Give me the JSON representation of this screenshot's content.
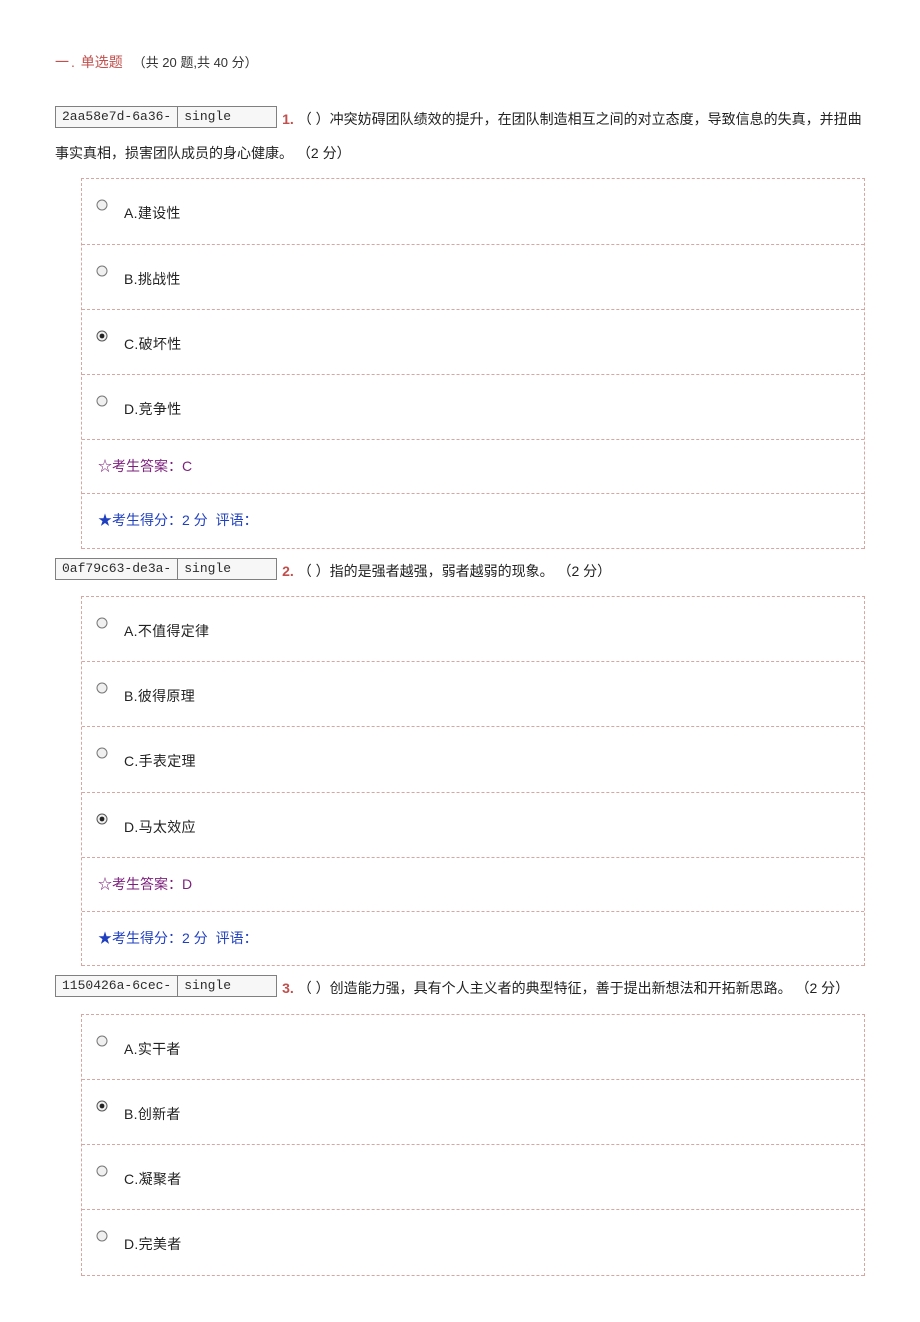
{
  "section": {
    "title_prefix": "一",
    "title_sep": ".",
    "title_main": "单选题",
    "stats": "（共 20 题,共 40 分）"
  },
  "questions": [
    {
      "tag_id": "2aa58e7d-6a36-",
      "tag_type": "single",
      "number": "1.",
      "text": "（   ）冲突妨碍团队绩效的提升，在团队制造相互之间的对立态度，导致信息的失真，并扭曲事实真相，损害团队成员的身心健康。",
      "points": "（2 分）",
      "options": [
        {
          "label": "A.建设性",
          "checked": false
        },
        {
          "label": "B.挑战性",
          "checked": false
        },
        {
          "label": "C.破坏性",
          "checked": true
        },
        {
          "label": "D.竞争性",
          "checked": false
        }
      ],
      "answer": {
        "star": "☆",
        "label": "考生答案：",
        "value": "C"
      },
      "score": {
        "star": "★",
        "label": "考生得分：",
        "value": "2 分",
        "comment_label": "评语："
      }
    },
    {
      "tag_id": "0af79c63-de3a-",
      "tag_type": "single",
      "number": "2.",
      "text": "（   ）指的是强者越强，弱者越弱的现象。",
      "points": "（2 分）",
      "options": [
        {
          "label": "A.不值得定律",
          "checked": false
        },
        {
          "label": "B.彼得原理",
          "checked": false
        },
        {
          "label": "C.手表定理",
          "checked": false
        },
        {
          "label": "D.马太效应",
          "checked": true
        }
      ],
      "answer": {
        "star": "☆",
        "label": "考生答案：",
        "value": "D"
      },
      "score": {
        "star": "★",
        "label": "考生得分：",
        "value": "2 分",
        "comment_label": "评语："
      }
    },
    {
      "tag_id": "1150426a-6cec-",
      "tag_type": "single",
      "number": "3.",
      "text": "（   ）创造能力强，具有个人主义者的典型特征，善于提出新想法和开拓新思路。",
      "points": "（2 分）",
      "options": [
        {
          "label": "A.实干者",
          "checked": false
        },
        {
          "label": "B.创新者",
          "checked": true
        },
        {
          "label": "C.凝聚者",
          "checked": false
        },
        {
          "label": "D.完美者",
          "checked": false
        }
      ]
    }
  ]
}
